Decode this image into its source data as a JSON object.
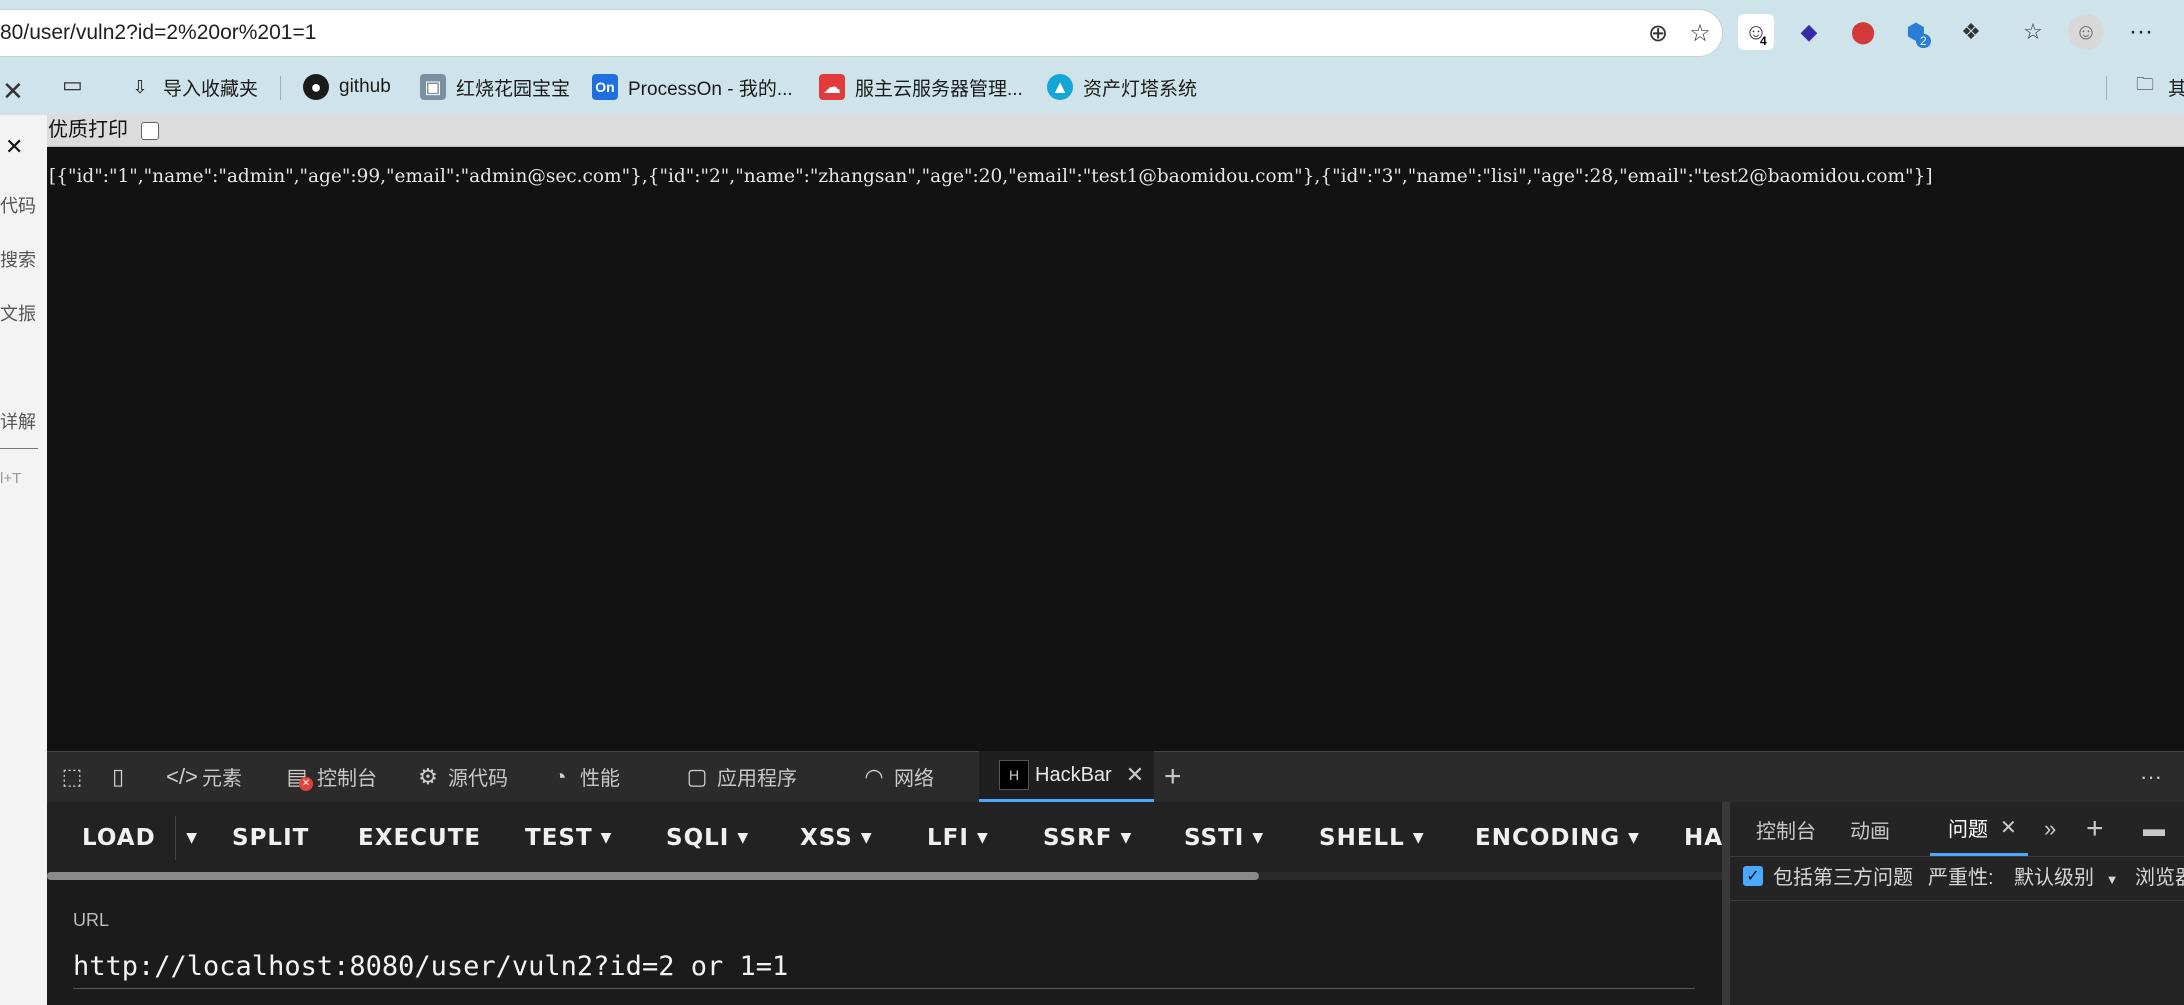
{
  "browser": {
    "url": "80/user/vuln2?id=2%20or%201=1",
    "extensions": [
      {
        "icon": "emoji-extension-icon",
        "badge": "4"
      },
      {
        "icon": "diamond-extension-icon"
      },
      {
        "icon": "stop-extension-icon"
      },
      {
        "icon": "shield-extension-icon",
        "badge": "2"
      },
      {
        "icon": "puzzle-icon"
      },
      {
        "icon": "favorites-icon"
      },
      {
        "icon": "avatar"
      }
    ],
    "more": "···"
  },
  "bookmarks": [
    {
      "label": "导入收藏夹",
      "icon": "import-icon"
    },
    {
      "label": "github",
      "icon": "github-icon"
    },
    {
      "label": "红烧花园宝宝",
      "icon": "image-icon"
    },
    {
      "label": "ProcessOn - 我的...",
      "icon": "processon-icon",
      "icon_text": "On"
    },
    {
      "label": "服主云服务器管理...",
      "icon": "cloud-icon"
    },
    {
      "label": "资产灯塔系统",
      "icon": "lighthouse-icon"
    }
  ],
  "bookmarks_overflow": "其",
  "side_panel": {
    "items": [
      "代码",
      "搜索",
      "文振",
      "详解",
      "l+T"
    ]
  },
  "page": {
    "print_label": "优质打印",
    "json_text": "[{\"id\":\"1\",\"name\":\"admin\",\"age\":99,\"email\":\"admin@sec.com\"},{\"id\":\"2\",\"name\":\"zhangsan\",\"age\":20,\"email\":\"test1@baomidou.com\"},{\"id\":\"3\",\"name\":\"lisi\",\"age\":28,\"email\":\"test2@baomidou.com\"}]"
  },
  "devtools": {
    "tabs": {
      "elements": "元素",
      "console": "控制台",
      "sources": "源代码",
      "performance": "性能",
      "application": "应用程序",
      "network": "网络",
      "hackbar": "HackBar"
    },
    "more": "···"
  },
  "hackbar": {
    "buttons": {
      "load": "LOAD",
      "split": "SPLIT",
      "execute": "EXECUTE",
      "test": "TEST",
      "sqli": "SQLI",
      "xss": "XSS",
      "lfi": "LFI",
      "ssrf": "SSRF",
      "ssti": "SSTI",
      "shell": "SHELL",
      "encoding": "ENCODING",
      "ha": "HA"
    },
    "url_label": "URL",
    "url_value": "http://localhost:8080/user/vuln2?id=2 or 1=1"
  },
  "drawer": {
    "tabs": {
      "console": "控制台",
      "animation": "动画",
      "issues": "问题"
    },
    "include_third_party": "包括第三方问题",
    "severity_label": "严重性:",
    "severity_value": "默认级别",
    "browser_label": "浏览器"
  }
}
